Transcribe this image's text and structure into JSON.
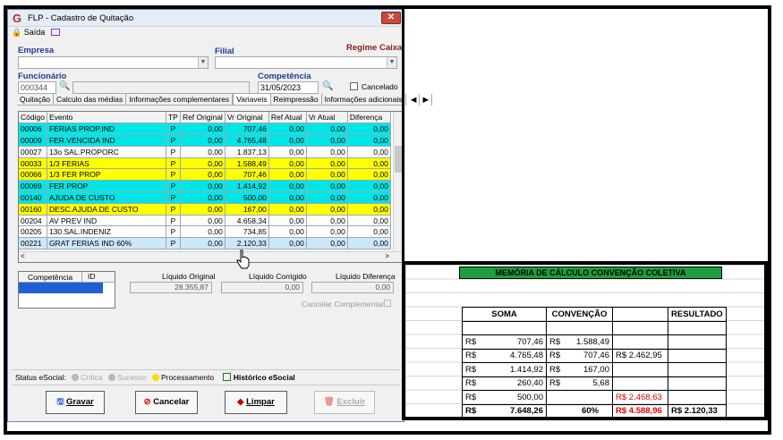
{
  "window": {
    "title": "FLP - Cadastro de Quitação",
    "close": "✕"
  },
  "menu": {
    "exit": "Saída"
  },
  "form": {
    "empresa_label": "Empresa",
    "filial_label": "Filial",
    "regime_label": "Regime Caixa",
    "funcionario_label": "Funcionário",
    "funcionario_value": "000344",
    "competencia_label": "Competência",
    "competencia_value": "31/05/2023",
    "cancelado_label": "Cancelado"
  },
  "tabs": [
    "Quitação",
    "Calculo das médias",
    "Informações complementares",
    "Variaveis",
    "Reimpressão",
    "Informações adicionais"
  ],
  "grid": {
    "columns": [
      "Código",
      "Evento",
      "TP",
      "Ref Original",
      "Vr Original",
      "Ref Atual",
      "Vr Atual",
      "Diferença"
    ],
    "rows": [
      {
        "style": "cyan",
        "cells": [
          "00006",
          "FERIAS PROP.IND",
          "P",
          "0,00",
          "707,46",
          "0,00",
          "0,00",
          "0,00"
        ]
      },
      {
        "style": "cyan",
        "cells": [
          "00009",
          "FER.VENCIDA IND",
          "P",
          "0,00",
          "4.765,48",
          "0,00",
          "0,00",
          "0,00"
        ]
      },
      {
        "style": "white",
        "cells": [
          "00027",
          "13o SAL.PROPORC",
          "P",
          "0,00",
          "1.837,13",
          "0,00",
          "0,00",
          "0,00"
        ]
      },
      {
        "style": "yellow",
        "cells": [
          "00033",
          "1/3 FERIAS",
          "P",
          "0,00",
          "1.588,49",
          "0,00",
          "0,00",
          "0,00"
        ]
      },
      {
        "style": "yellow",
        "cells": [
          "00066",
          "1/3 FER PROP",
          "P",
          "0,00",
          "707,46",
          "0,00",
          "0,00",
          "0,00"
        ]
      },
      {
        "style": "cyan",
        "cells": [
          "00069",
          "FER PROP",
          "P",
          "0,00",
          "1.414,92",
          "0,00",
          "0,00",
          "0,00"
        ]
      },
      {
        "style": "cyan",
        "cells": [
          "00140",
          "AJUDA DE CUSTO",
          "P",
          "0,00",
          "500,00",
          "0,00",
          "0,00",
          "0,00"
        ]
      },
      {
        "style": "yellow",
        "cells": [
          "00160",
          "DESC.AJUDA DE CUSTO",
          "P",
          "0,00",
          "167,00",
          "0,00",
          "0,00",
          "0,00"
        ]
      },
      {
        "style": "white",
        "cells": [
          "00204",
          "AV PREV IND",
          "P",
          "0,00",
          "4.658,34",
          "0,00",
          "0,00",
          "0,00"
        ]
      },
      {
        "style": "white",
        "cells": [
          "00205",
          "130.SAL.INDENIZ",
          "P",
          "0,00",
          "734,85",
          "0,00",
          "0,00",
          "0,00"
        ]
      },
      {
        "style": "sel",
        "cells": [
          "00221",
          "GRAT FERIAS IND 60%",
          "P",
          "0,00",
          "2.120,33",
          "0,00",
          "0,00",
          "0,00"
        ]
      }
    ]
  },
  "mini_grid": {
    "col1": "Competência",
    "col2": "ID"
  },
  "totals": {
    "liq_original_label": "Líquido Original",
    "liq_original_value": "28.355,87",
    "liq_corrigido_label": "Líquido Corrigido",
    "liq_corrigido_value": "0,00",
    "liq_diferenca_label": "Líquido Diferença",
    "liq_diferenca_value": "0,00",
    "cancel_comp_label": "Cancelar Complementar"
  },
  "status": {
    "label": "Status eSocial:",
    "critica": "Crítica",
    "sucesso": "Sucesso",
    "processamento": "Processamento",
    "historico": "Histórico eSocial"
  },
  "buttons": {
    "gravar": "Gravar",
    "cancelar": "Cancelar",
    "limpar": "Limpar",
    "excluir": "Excluir"
  },
  "sheet": {
    "title": "MEMÓRIA DE CÁLCULO CONVENÇÃO COLETIVA",
    "headers": [
      "SOMA",
      "CONVENÇÃO",
      "",
      "RESULTADO"
    ],
    "rows": [
      [
        "",
        "",
        "",
        ""
      ],
      [
        "R$",
        "707,46",
        "R$",
        "1.588,49",
        "",
        ""
      ],
      [
        "R$",
        "4.765,48",
        "R$",
        "707,46",
        "R$ 2.462,95",
        ""
      ],
      [
        "R$",
        "1.414,92",
        "R$",
        "167,00",
        "",
        ""
      ],
      [
        "R$",
        "260,40",
        "R$",
        "5,68",
        "",
        ""
      ],
      [
        "R$",
        "500,00",
        "",
        "",
        "R$ 2.468,63",
        ""
      ],
      [
        "R$",
        "7.648,26",
        "",
        "60%",
        "R$ 4.588,96",
        "R$ 2.120,33"
      ]
    ]
  },
  "colors": {
    "cyan": "#00e6e6",
    "yellow": "#ffff00",
    "green_header": "#1e9e3e",
    "red_text": "#e00000"
  }
}
